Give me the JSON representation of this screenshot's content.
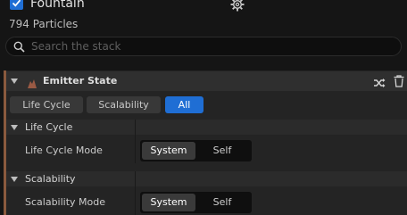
{
  "header": {
    "title": "Fountain",
    "particle_count": "794 Particles",
    "enabled": true
  },
  "search": {
    "placeholder": "Search the stack",
    "value": ""
  },
  "emitter": {
    "label": "Emitter State",
    "accent_color": "#8a5a3e"
  },
  "filter_tabs": [
    {
      "label": "Life Cycle",
      "selected": false
    },
    {
      "label": "Scalability",
      "selected": false
    },
    {
      "label": "All",
      "selected": true
    }
  ],
  "sections": [
    {
      "title": "Life Cycle",
      "row_label": "Life Cycle Mode",
      "options": [
        "System",
        "Self"
      ],
      "selected": "System"
    },
    {
      "title": "Scalability",
      "row_label": "Scalability Mode",
      "options": [
        "System",
        "Self"
      ],
      "selected": "System"
    }
  ],
  "colors": {
    "accent_blue": "#1f6ed4",
    "background": "#151515",
    "panel": "#242424"
  }
}
